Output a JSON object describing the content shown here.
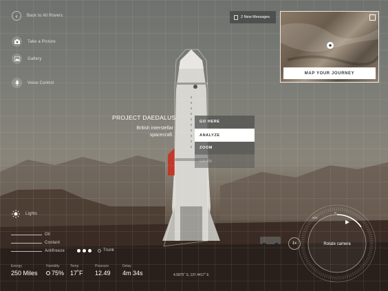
{
  "nav": {
    "back_label": "Back to All Rovers"
  },
  "tools": [
    {
      "label": "Take a Picture",
      "icon": "camera-icon"
    },
    {
      "label": "Gallery",
      "icon": "image-icon"
    },
    {
      "label": "Voice Control",
      "icon": "microphone-icon"
    }
  ],
  "messages": {
    "label": "2 New Messages"
  },
  "map": {
    "button_label": "MAP YOUR JOURNEY"
  },
  "project": {
    "title": "PROJECT DAEDALUS",
    "subtitle_line1": "British interstellar",
    "subtitle_line2": "spacecraft."
  },
  "menu": {
    "items": [
      "GO HERE",
      "ANALYZE",
      "ZOOM",
      "GRAB"
    ]
  },
  "lights": {
    "label": "Lights"
  },
  "fluids": [
    {
      "label": "Oil",
      "level": 0.55
    },
    {
      "label": "Coolant",
      "level": 0.55
    },
    {
      "label": "Antifreeze",
      "level": 0.55
    }
  ],
  "trunk": {
    "label": "Trunk"
  },
  "stats": [
    {
      "label": "Energy",
      "value": "250 Miles"
    },
    {
      "label": "Humidity",
      "value": "75%"
    },
    {
      "label": "Temp",
      "value": "17˚F"
    },
    {
      "label": "Pressure",
      "value": "12.49"
    },
    {
      "label": "Delay",
      "value": "4m 34s"
    }
  ],
  "coordinates": "4.5875˚ S, 137.4417˚ E",
  "camera": {
    "zoom_label": "1x",
    "rotate_label": "Rotate camera",
    "compass_n": "N",
    "compass_nw": "NW"
  },
  "colors": {
    "accent_red": "#c0392b",
    "panel": "#505250"
  }
}
